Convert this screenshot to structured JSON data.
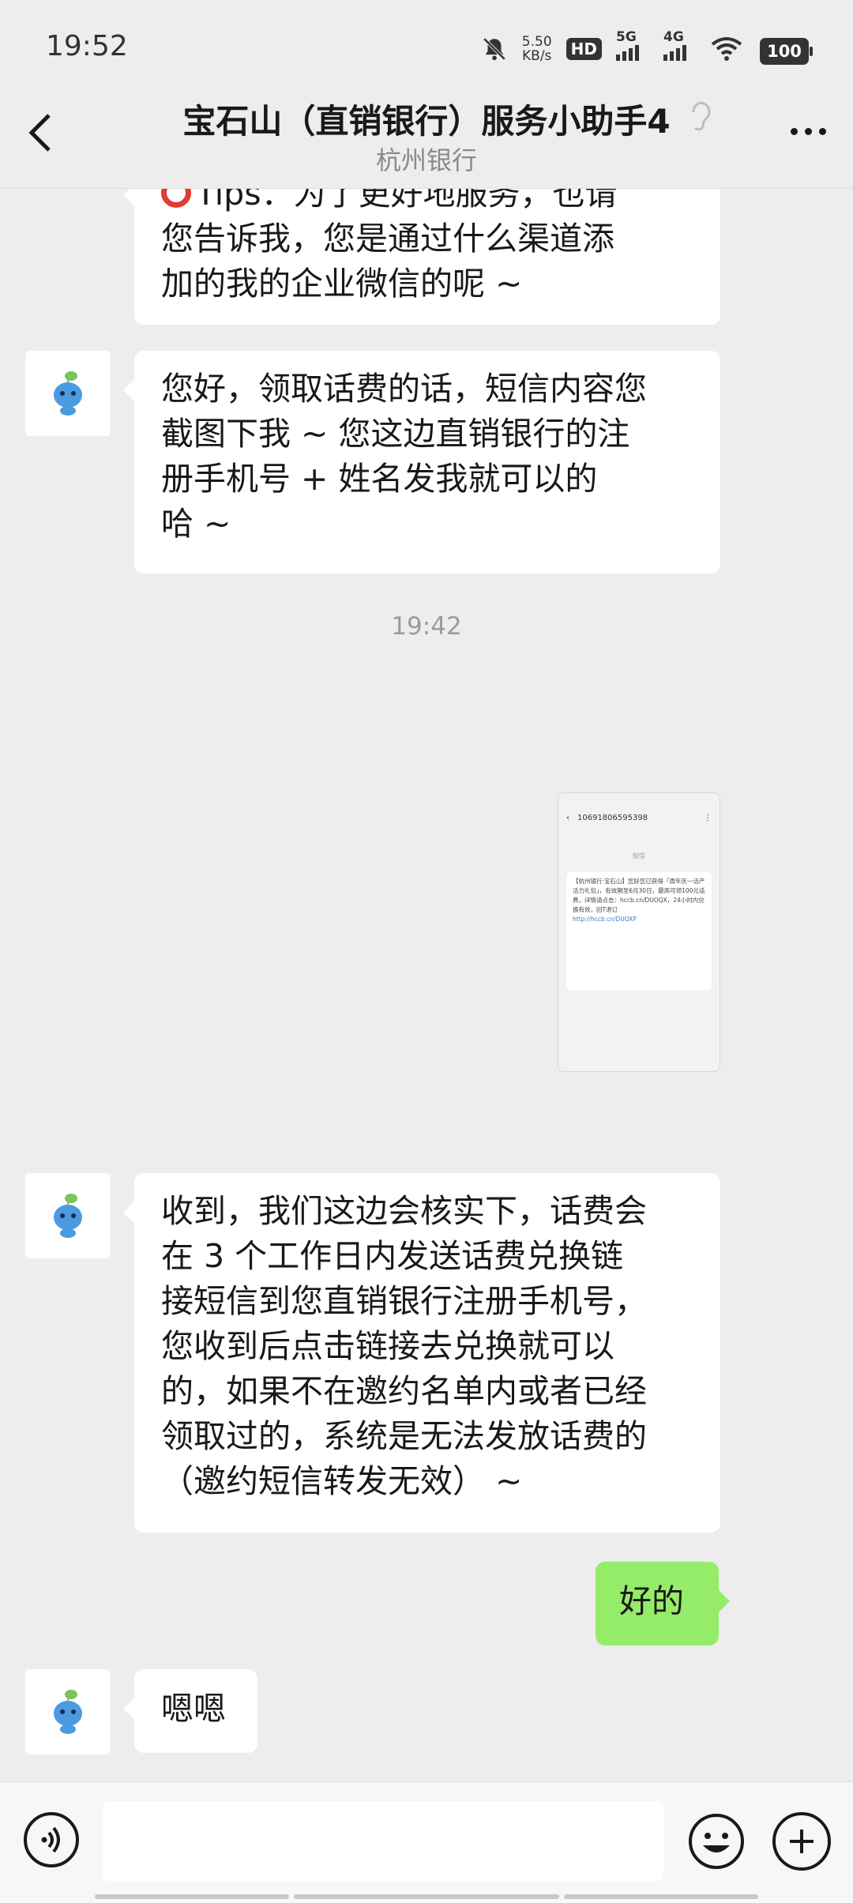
{
  "status_bar": {
    "time": "19:52",
    "net_speed_value": "5.50",
    "net_speed_unit": "KB/s",
    "hd_label": "HD",
    "sim1_label": "5G",
    "sim2_label": "4G",
    "battery": "100"
  },
  "header": {
    "title": "宝石山（直销银行）服务小助手4",
    "subtitle": "杭州银行",
    "icons": [
      "back-icon",
      "ear-icon",
      "more-icon"
    ]
  },
  "messages": [
    {
      "side": "left",
      "lines": [
        "Tips：为了更好地服务，也请",
        "您告诉我，您是通过什么渠道添",
        "加的我的企业微信的呢 ~"
      ]
    },
    {
      "side": "left",
      "lines": [
        "您好，领取话费的话，短信内容您",
        "截图下我 ~ 您这边直销银行的注",
        "册手机号 + 姓名发我就可以的",
        "哈 ~"
      ]
    },
    {
      "type": "time",
      "text": "19:42"
    },
    {
      "side": "right",
      "type": "image",
      "sms": {
        "number": "10691806595398",
        "brand_line": "短信",
        "body": "【杭州银行·宝石山】您好您已获得「周年庆一活产活力礼包」，有效期至6月30日，最高可领100元话费，详情请点击：hccb.cn/DUOQX，24小时内兑换有效，回T退订",
        "link": "http://hccb.cn/DUOXP"
      }
    },
    {
      "side": "left",
      "lines": [
        "收到，我们这边会核实下，话费会",
        "在 3 个工作日内发送话费兑换链",
        "接短信到您直销银行注册手机号，",
        "您收到后点击链接去兑换就可以",
        "的，如果不在邀约名单内或者已经",
        "领取过的，系统是无法发放话费的",
        "（邀约短信转发无效） ~"
      ]
    },
    {
      "side": "right",
      "lines": [
        "好的"
      ]
    },
    {
      "side": "left",
      "lines": [
        "嗯嗯"
      ]
    }
  ],
  "input_bar": {
    "input_value": "",
    "icons": [
      "voice-icon",
      "emoji-icon",
      "plus-icon"
    ]
  }
}
